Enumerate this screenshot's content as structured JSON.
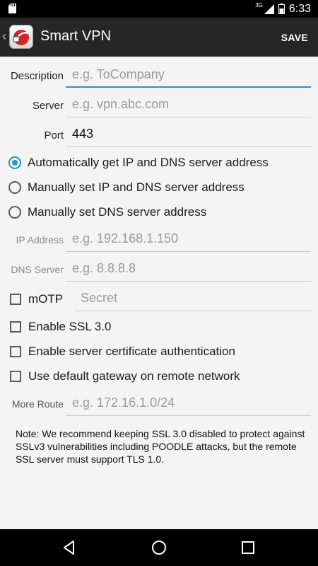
{
  "status_bar": {
    "network": "3G",
    "time": "6:33"
  },
  "app": {
    "title": "Smart VPN",
    "save_label": "SAVE"
  },
  "form": {
    "description": {
      "label": "Description",
      "placeholder": "e.g. ToCompany"
    },
    "server": {
      "label": "Server",
      "placeholder": "e.g. vpn.abc.com"
    },
    "port": {
      "label": "Port",
      "value": "443"
    },
    "radio_options": [
      {
        "label": "Automatically get IP and DNS server address",
        "selected": true
      },
      {
        "label": "Manually set IP and DNS server address",
        "selected": false
      },
      {
        "label": "Manually set DNS server address",
        "selected": false
      }
    ],
    "ip_address": {
      "label": "IP Address",
      "placeholder": "e.g. 192.168.1.150"
    },
    "dns_server": {
      "label": "DNS Server",
      "placeholder": "e.g. 8.8.8.8"
    },
    "motp": {
      "label": "mOTP",
      "placeholder": "Secret",
      "checked": false
    },
    "checkboxes": [
      {
        "label": "Enable SSL 3.0",
        "checked": false
      },
      {
        "label": "Enable server certificate authentication",
        "checked": false
      },
      {
        "label": "Use default gateway on remote network",
        "checked": false
      }
    ],
    "more_route": {
      "label": "More Route",
      "placeholder": "e.g. 172.16.1.0/24"
    }
  },
  "note": "Note: We recommend keeping SSL 3.0 disabled to protect against SSLv3 vulnerabilities including POODLE attacks, but the remote SSL server must support TLS 1.0.",
  "icons": {
    "sd_card": "sd-card-icon",
    "signal": "signal-icon",
    "battery": "battery-icon",
    "back_arrow": "chevron-left-icon",
    "logo": "smart-vpn-logo-icon",
    "nav_back": "nav-back-icon",
    "nav_home": "nav-home-icon",
    "nav_recents": "nav-recents-icon"
  },
  "colors": {
    "accent": "#2a93c5",
    "action_bar": "#262626",
    "background": "#f4f4f4"
  }
}
